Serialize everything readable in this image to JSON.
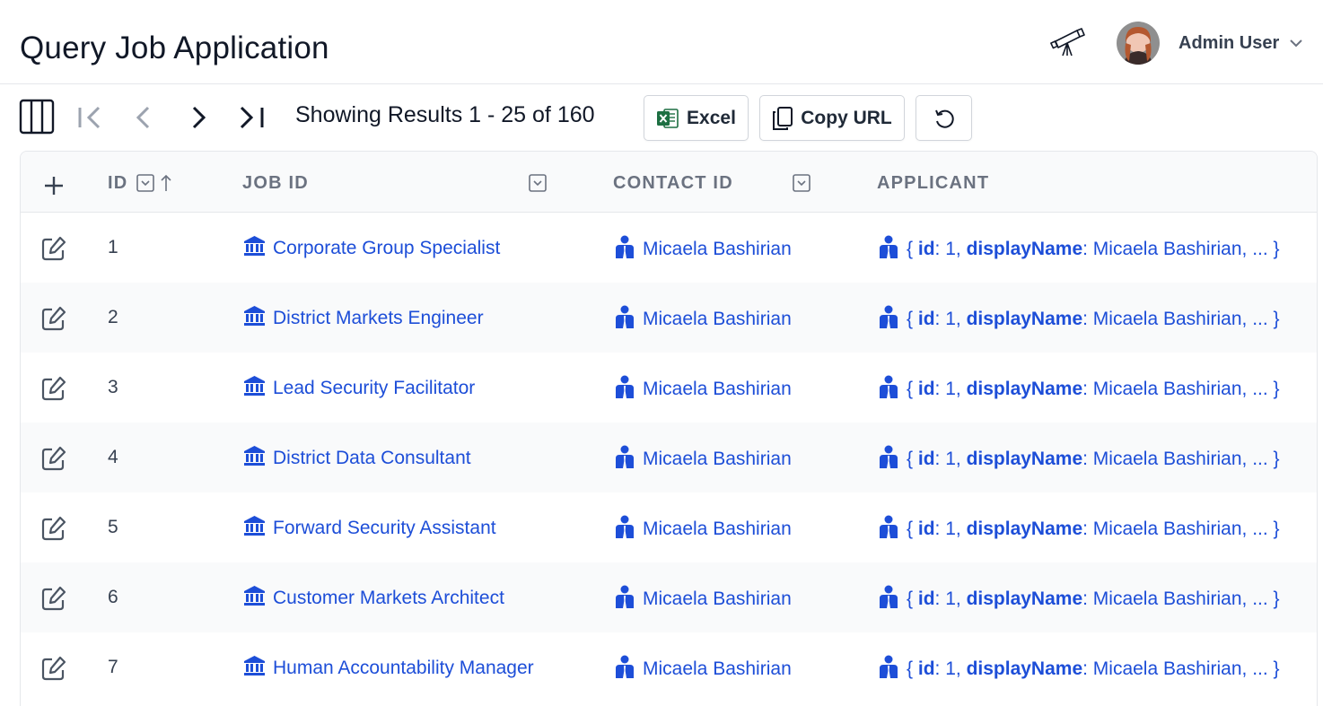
{
  "header": {
    "title": "Query Job Application",
    "user_name": "Admin User"
  },
  "toolbar": {
    "results_text": "Showing Results 1 - 25 of 160",
    "excel_label": "Excel",
    "copy_url_label": "Copy URL"
  },
  "table": {
    "columns": {
      "id": "ID",
      "job_id": "JOB ID",
      "contact_id": "CONTACT ID",
      "applicant": "APPLICANT"
    },
    "applicant_key_id": "id",
    "applicant_key_name": "displayName",
    "rows": [
      {
        "id": "1",
        "job": "Corporate Group Specialist",
        "contact": "Micaela Bashirian",
        "app_open": "{ ",
        "app_id_val": ": 1, ",
        "app_name_val": ": Micaela Bashirian, ... }"
      },
      {
        "id": "2",
        "job": "District Markets Engineer",
        "contact": "Micaela Bashirian",
        "app_open": "{ ",
        "app_id_val": ": 1, ",
        "app_name_val": ": Micaela Bashirian, ... }"
      },
      {
        "id": "3",
        "job": "Lead Security Facilitator",
        "contact": "Micaela Bashirian",
        "app_open": "{ ",
        "app_id_val": ": 1, ",
        "app_name_val": ": Micaela Bashirian, ... }"
      },
      {
        "id": "4",
        "job": "District Data Consultant",
        "contact": "Micaela Bashirian",
        "app_open": "{ ",
        "app_id_val": ": 1, ",
        "app_name_val": ": Micaela Bashirian, ... }"
      },
      {
        "id": "5",
        "job": "Forward Security Assistant",
        "contact": "Micaela Bashirian",
        "app_open": "{ ",
        "app_id_val": ": 1, ",
        "app_name_val": ": Micaela Bashirian, ... }"
      },
      {
        "id": "6",
        "job": "Customer Markets Architect",
        "contact": "Micaela Bashirian",
        "app_open": "{ ",
        "app_id_val": ": 1, ",
        "app_name_val": ": Micaela Bashirian, ... }"
      },
      {
        "id": "7",
        "job": "Human Accountability Manager",
        "contact": "Micaela Bashirian",
        "app_open": "{ ",
        "app_id_val": ": 1, ",
        "app_name_val": ": Micaela Bashirian, ... }"
      }
    ]
  },
  "icons": {
    "telescope": "telescope-icon",
    "columns": "columns-icon",
    "first": "first-page-icon",
    "prev": "previous-page-icon",
    "next": "next-page-icon",
    "last": "last-page-icon",
    "excel": "excel-icon",
    "copy": "copy-icon",
    "reset": "reset-icon",
    "edit": "edit-icon",
    "job": "bank-icon",
    "person": "person-icon"
  },
  "colors": {
    "link": "#1d4ed8",
    "excel_green": "#1d6f42",
    "row_alt": "#f9fafb"
  }
}
